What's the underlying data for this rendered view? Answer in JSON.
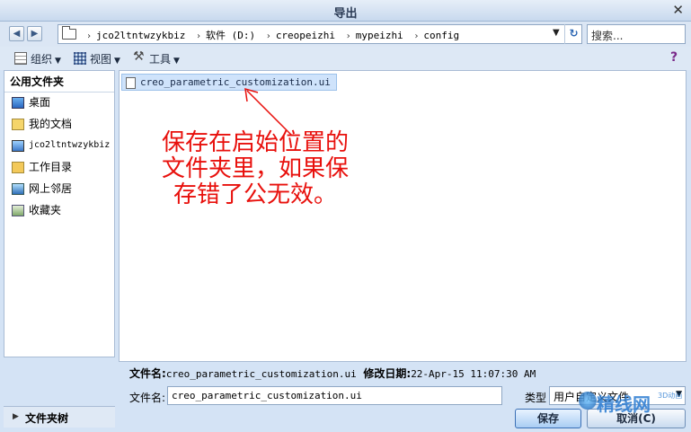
{
  "window": {
    "title": "导出"
  },
  "nav": {
    "back_icon": "back-arrow-icon",
    "forward_icon": "forward-arrow-icon",
    "breadcrumbs": [
      "jco2ltntwzykbiz",
      "软件 (D:)",
      "creopeizhi",
      "mypeizhi",
      "config"
    ],
    "search_placeholder": "搜索..."
  },
  "toolbar": {
    "organize": "组织",
    "views": "视图",
    "tools": "工具"
  },
  "sidebar": {
    "title": "公用文件夹",
    "items": [
      {
        "label": "桌面",
        "icon": "desktop-icon"
      },
      {
        "label": "我的文档",
        "icon": "documents-icon"
      },
      {
        "label": "jco2ltntwzykbiz",
        "icon": "computer-icon"
      },
      {
        "label": "工作目录",
        "icon": "working-dir-icon"
      },
      {
        "label": "网上邻居",
        "icon": "network-icon"
      },
      {
        "label": "收藏夹",
        "icon": "favorites-icon"
      }
    ],
    "folder_tree": "文件夹树"
  },
  "files": [
    {
      "name": "creo_parametric_customization.ui",
      "selected": true
    }
  ],
  "annotation": {
    "text": "保存在启始位置的文件夹里，如果保存错了公无效。",
    "color": "#e8100c"
  },
  "info": {
    "filename_label": "文件名:",
    "filename_value": "creo_parametric_customization.ui",
    "modified_label": "修改日期:",
    "modified_value": "22-Apr-15 11:07:30 AM"
  },
  "form": {
    "filename_label": "文件名:",
    "filename_value": "creo_parametric_customization.ui",
    "type_label": "类型",
    "type_value": "用户自定义文件"
  },
  "buttons": {
    "save": "保存",
    "cancel": "取消(C)"
  },
  "watermark": {
    "text": "精线网",
    "sub": "3D动画"
  }
}
